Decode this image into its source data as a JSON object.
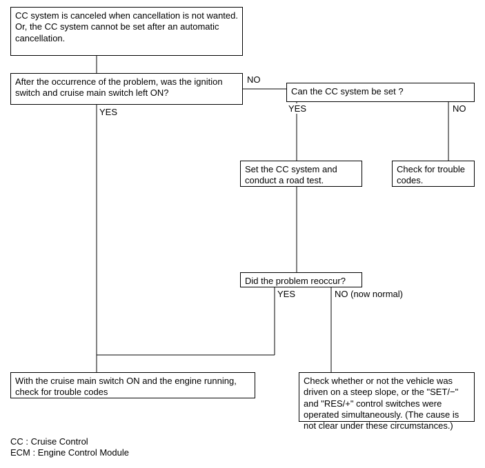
{
  "chart_data": {
    "type": "flowchart",
    "nodes": [
      {
        "id": "start",
        "text": "CC system is canceled when cancellation is not wanted.\nOr, the CC system cannot be set after an automatic cancellation."
      },
      {
        "id": "q1",
        "text": "After the occurrence of the problem, was the ignition switch and cruise main switch left ON?"
      },
      {
        "id": "q2",
        "text": "Can the CC system be set ?"
      },
      {
        "id": "step1",
        "text": "Set the CC system and conduct a road test."
      },
      {
        "id": "check1",
        "text": "Check for trouble codes."
      },
      {
        "id": "q3",
        "text": "Did the problem reoccur?"
      },
      {
        "id": "action1",
        "text": "With the cruise main switch ON and the engine running, check for trouble codes"
      },
      {
        "id": "action2",
        "text": "Check whether or not the vehicle was driven on a steep slope, or the \"SET/−\" and \"RES/+\" control switches were operated simultaneously. (The cause is not clear under these circumstances.)"
      }
    ],
    "edges": [
      {
        "from": "start",
        "to": "q1",
        "label": ""
      },
      {
        "from": "q1",
        "to": "q2",
        "label": "NO"
      },
      {
        "from": "q1",
        "to": "action1",
        "label": "YES"
      },
      {
        "from": "q2",
        "to": "step1",
        "label": "YES"
      },
      {
        "from": "q2",
        "to": "check1",
        "label": "NO"
      },
      {
        "from": "step1",
        "to": "q3",
        "label": ""
      },
      {
        "from": "q3",
        "to": "action1",
        "label": "YES"
      },
      {
        "from": "q3",
        "to": "action2",
        "label": "NO (now normal)"
      }
    ],
    "legend": [
      "CC : Cruise Control",
      "ECM : Engine Control Module"
    ]
  }
}
